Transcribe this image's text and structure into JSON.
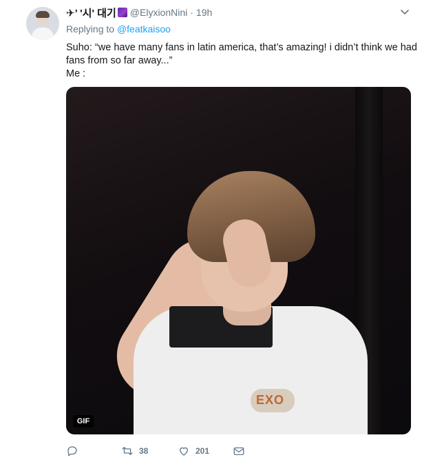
{
  "tweet": {
    "display_name": "✈’ '시' 대기",
    "handle": "@ElyxionNini",
    "separator": "·",
    "time": "19h",
    "replying_to_prefix": "Replying to",
    "replying_to_user": "@featkaisoo",
    "text_line1": "Suho: “we have many fans in latin america, that’s amazing! i didn’t think we had",
    "text_line2": "fans from so far away...”",
    "text_line3": "Me :",
    "media": {
      "badge": "GIF",
      "logo_text": "EXO"
    },
    "actions": {
      "replies": "",
      "retweets": "38",
      "likes": "201"
    }
  },
  "colors": {
    "link": "#1da1f2",
    "muted": "#657786",
    "text": "#14171a"
  }
}
